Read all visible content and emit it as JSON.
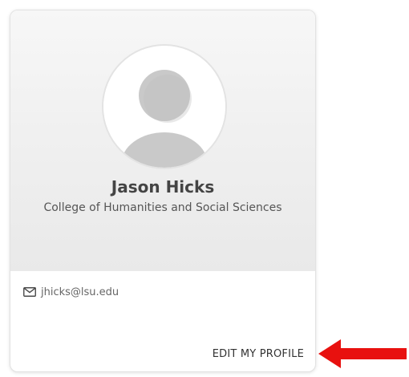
{
  "profile": {
    "name": "Jason Hicks",
    "department": "College of Humanities and Social Sciences",
    "email": "jhicks@lsu.edu",
    "edit_label": "EDIT MY PROFILE"
  },
  "icons": {
    "avatar": "user-placeholder-icon",
    "email": "envelope-icon",
    "pointer": "red-arrow-icon"
  },
  "colors": {
    "arrow": "#e8110f",
    "avatar_figure": "#c8c8c8"
  }
}
